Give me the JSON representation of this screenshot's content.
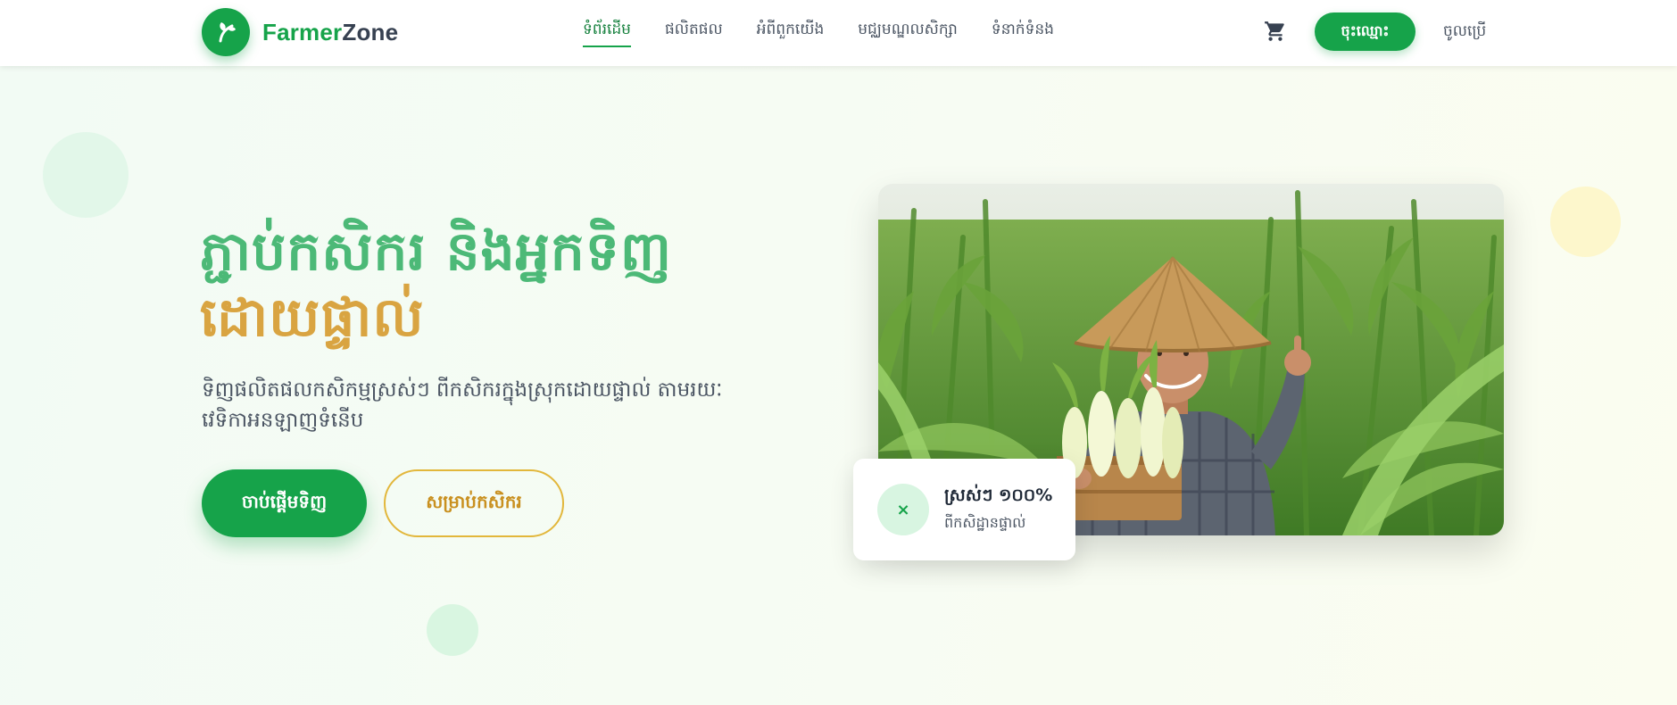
{
  "brand": {
    "name_part1": "Farmer",
    "name_part2": "Zone",
    "primary_color": "#16a34a",
    "accent_color": "#d9a441",
    "logo_icon": "sprout-icon"
  },
  "nav": {
    "links": [
      {
        "label": "ទំព័រដើម",
        "active": true
      },
      {
        "label": "ផលិតផល",
        "active": false
      },
      {
        "label": "អំពីពួកយើង",
        "active": false
      },
      {
        "label": "មជ្ឈមណ្ឌលសិក្សា",
        "active": false
      },
      {
        "label": "ទំនាក់ទំនង",
        "active": false
      }
    ],
    "cart_icon": "cart-icon",
    "register_label": "ចុះឈ្មោះ",
    "login_label": "ចូលប្រើ"
  },
  "hero": {
    "title_line1": "ភ្ជាប់កសិករ និងអ្នកទិញ",
    "title_line2": "ដោយផ្ទាល់",
    "subtitle": "ទិញផលិតផលកសិកម្មស្រស់ៗ ពីកសិករក្នុងស្រុកដោយផ្ទាល់ តាមរយៈវេទិកាអនឡាញទំនើប",
    "primary_cta": "ចាប់ផ្តើមទិញ",
    "secondary_cta": "សម្រាប់កសិករ"
  },
  "stat_card": {
    "icon": "×",
    "value": "ស្រស់ៗ ១០០%",
    "label": "ពីកសិដ្ឋានផ្ទាល់"
  }
}
